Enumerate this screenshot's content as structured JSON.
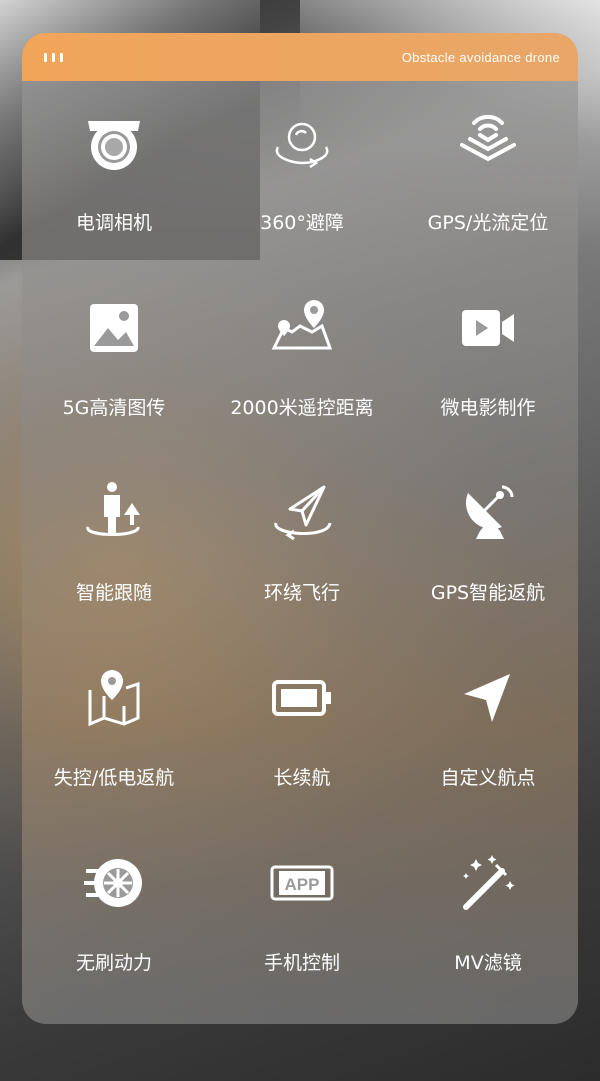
{
  "header": {
    "title": "Obstacle avoidance drone"
  },
  "features": [
    {
      "label": "电调相机",
      "icon": "camera-icon"
    },
    {
      "label": "360°避障",
      "icon": "obstacle-avoidance-icon"
    },
    {
      "label": "GPS/光流定位",
      "icon": "signal-waves-icon"
    },
    {
      "label": "5G高清图传",
      "icon": "image-icon"
    },
    {
      "label": "2000米遥控距离",
      "icon": "map-route-icon"
    },
    {
      "label": "微电影制作",
      "icon": "video-camera-icon"
    },
    {
      "label": "智能跟随",
      "icon": "person-follow-icon"
    },
    {
      "label": "环绕飞行",
      "icon": "paper-plane-orbit-icon"
    },
    {
      "label": "GPS智能返航",
      "icon": "satellite-dish-icon"
    },
    {
      "label": "失控/低电返航",
      "icon": "map-pin-icon"
    },
    {
      "label": "长续航",
      "icon": "battery-icon"
    },
    {
      "label": "自定义航点",
      "icon": "navigation-arrow-icon"
    },
    {
      "label": "无刷动力",
      "icon": "motor-icon"
    },
    {
      "label": "手机控制",
      "icon": "app-phone-icon"
    },
    {
      "label": "MV滤镜",
      "icon": "magic-wand-icon"
    }
  ]
}
